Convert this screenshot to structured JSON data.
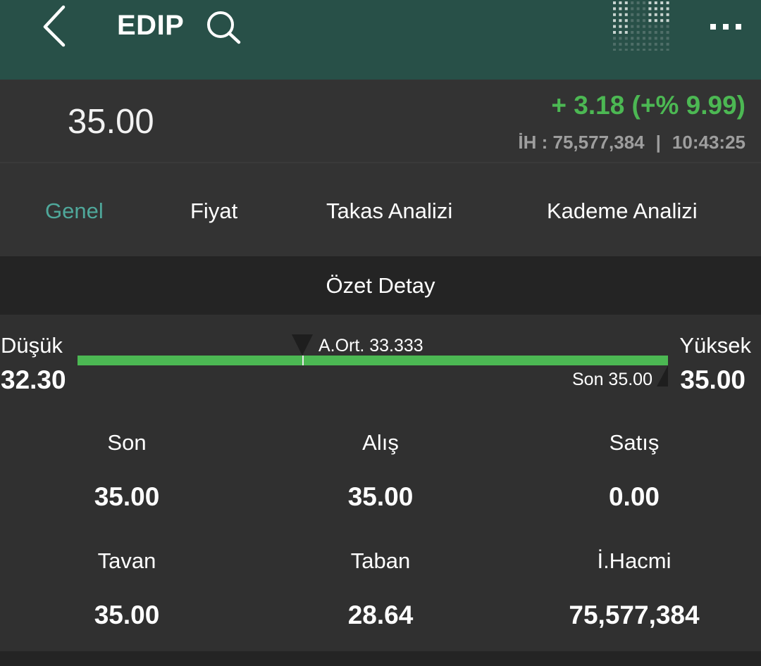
{
  "header": {
    "symbol": "EDIP",
    "back_icon": "chevron-left-icon",
    "search_icon": "search-icon",
    "logo_icon": "dot-matrix-logo-icon",
    "more_icon": "more-horizontal-icon"
  },
  "price": {
    "last": "35.00",
    "change": "+ 3.18 (+% 9.99)",
    "volume_label": "İH :",
    "volume": "75,577,384",
    "separator": "|",
    "time": "10:43:25"
  },
  "tabs": [
    {
      "label": "Genel",
      "active": true
    },
    {
      "label": "Fiyat",
      "active": false
    },
    {
      "label": "Takas Analizi",
      "active": false
    },
    {
      "label": "Kademe Analizi",
      "active": false
    }
  ],
  "section": {
    "title": "Özet Detay"
  },
  "range": {
    "low_label": "Düşük",
    "low_value": "32.30",
    "high_label": "Yüksek",
    "high_value": "35.00",
    "avg_label": "A.Ort. 33.333",
    "last_label": "Son 35.00"
  },
  "summary": [
    {
      "label": "Son",
      "value": "35.00"
    },
    {
      "label": "Alış",
      "value": "35.00"
    },
    {
      "label": "Satış",
      "value": "0.00"
    },
    {
      "label": "Tavan",
      "value": "35.00"
    },
    {
      "label": "Taban",
      "value": "28.64"
    },
    {
      "label": "İ.Hacmi",
      "value": "75,577,384"
    }
  ],
  "colors": {
    "header_bg": "#285048",
    "positive": "#4cb853",
    "active_tab": "#4fa89b"
  }
}
